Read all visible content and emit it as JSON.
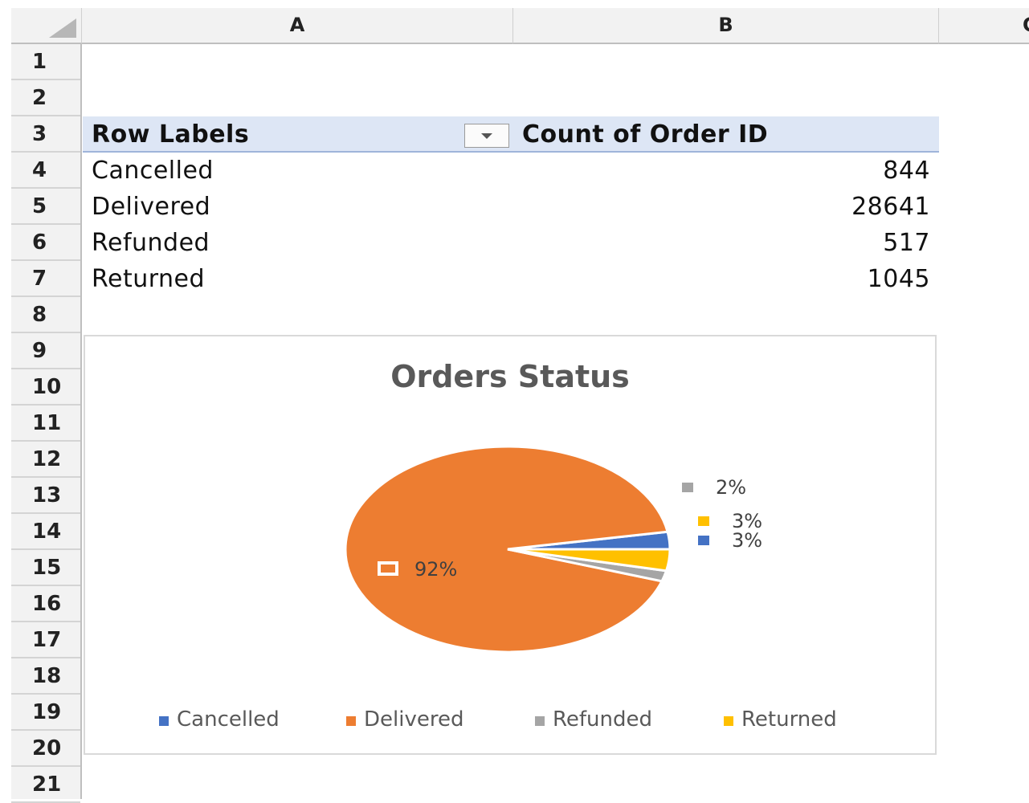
{
  "columns": [
    "A",
    "B",
    "C"
  ],
  "rows": [
    "1",
    "2",
    "3",
    "4",
    "5",
    "6",
    "7",
    "8",
    "9",
    "10",
    "11",
    "12",
    "13",
    "14",
    "15",
    "16",
    "17",
    "18",
    "19",
    "20",
    "21"
  ],
  "pivot": {
    "header_row_labels": "Row Labels",
    "header_value": "Count of Order ID",
    "items": [
      {
        "label": "Cancelled",
        "value": "844"
      },
      {
        "label": "Delivered",
        "value": "28641"
      },
      {
        "label": "Refunded",
        "value": "517"
      },
      {
        "label": "Returned",
        "value": "1045"
      }
    ]
  },
  "chart_data": {
    "type": "pie",
    "title": "Orders Status",
    "categories": [
      "Cancelled",
      "Delivered",
      "Refunded",
      "Returned"
    ],
    "values": [
      844,
      28641,
      517,
      1045
    ],
    "data_labels": [
      "3%",
      "92%",
      "2%",
      "3%"
    ],
    "colors": [
      "#4472c4",
      "#ed7d31",
      "#a5a5a5",
      "#ffc000"
    ],
    "legend": {
      "position": "bottom",
      "entries": [
        "Cancelled",
        "Delivered",
        "Refunded",
        "Returned"
      ]
    }
  },
  "colors": {
    "pivot_header_bg": "#dde6f5",
    "header_bg": "#f2f2f2"
  }
}
